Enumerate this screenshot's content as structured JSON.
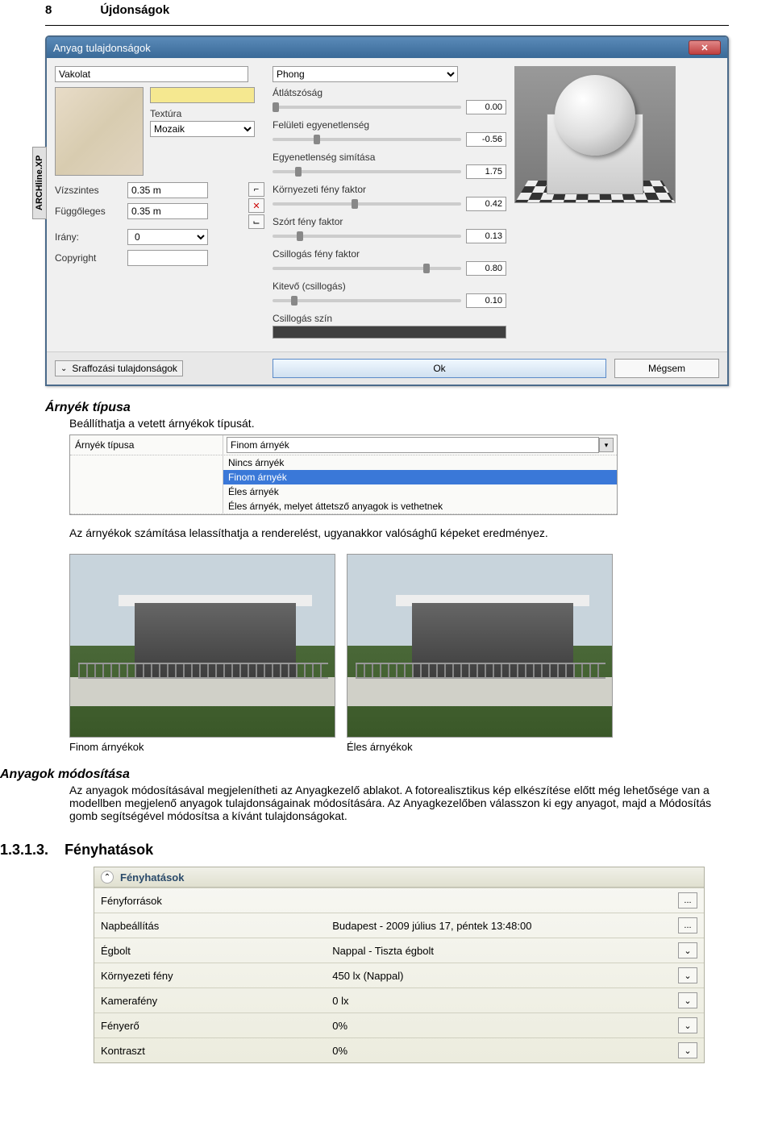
{
  "page": {
    "number": "8",
    "header": "Újdonságok"
  },
  "dialog": {
    "title": "Anyag tulajdonságok",
    "sideTab": "ARCHline.XP",
    "nameValue": "Vakolat",
    "textureLabel": "Textúra",
    "textureValue": "Mozaik",
    "rows": {
      "horizontal": {
        "label": "Vízszintes",
        "value": "0.35 m"
      },
      "vertical": {
        "label": "Függőleges",
        "value": "0.35 m"
      },
      "direction": {
        "label": "Irány:",
        "value": "0"
      },
      "copyright": {
        "label": "Copyright",
        "value": ""
      }
    },
    "shader": {
      "value": "Phong"
    },
    "sliders": {
      "transparency": {
        "label": "Átlátszóság",
        "value": "0.00",
        "pos": 0
      },
      "bump": {
        "label": "Felületi egyenetlenség",
        "value": "-0.56",
        "pos": 22
      },
      "bumpSmooth": {
        "label": "Egyenetlenség simítása",
        "value": "1.75",
        "pos": 12
      },
      "ambient": {
        "label": "Környezeti fény faktor",
        "value": "0.42",
        "pos": 42
      },
      "diffuse": {
        "label": "Szórt fény faktor",
        "value": "0.13",
        "pos": 13
      },
      "specular": {
        "label": "Csillogás fény faktor",
        "value": "0.80",
        "pos": 80
      },
      "specExp": {
        "label": "Kitevő (csillogás)",
        "value": "0.10",
        "pos": 10
      },
      "specColor": {
        "label": "Csillogás szín"
      }
    },
    "footer": {
      "sraf": "Sraffozási tulajdonságok",
      "ok": "Ok",
      "cancel": "Mégsem"
    }
  },
  "article": {
    "shadowTitle": "Árnyék típusa",
    "shadowIntro": "Beállíthatja a vetett árnyékok típusát.",
    "shadowNote": "Az árnyékok számítása lelassíthatja a renderelést, ugyanakkor valósághű képeket eredményez.",
    "cap1": "Finom árnyékok",
    "cap2": "Éles árnyékok",
    "matTitle": "Anyagok módosítása",
    "matBody": "Az anyagok módosításával megjelenítheti az Anyagkezelő ablakot. A fotorealisztikus kép elkészítése előtt még lehetősége van a modellben megjelenő anyagok tulajdonságainak módosítására. Az Anyagkezelőben válasszon ki egy anyagot, majd a Módosítás gomb segítségével módosítsa a kívánt tulajdonságokat.",
    "sectionNum": "1.3.1.3.",
    "sectionTitle": "Fényhatások"
  },
  "shadowPanel": {
    "label": "Árnyék típusa",
    "value": "Finom árnyék",
    "options": [
      "Nincs árnyék",
      "Finom árnyék",
      "Éles árnyék",
      "Éles árnyék, melyet áttetsző anyagok is vethetnek"
    ],
    "selectedIndex": 1
  },
  "lightPanel": {
    "title": "Fényhatások",
    "rows": [
      {
        "label": "Fényforrások",
        "value": "",
        "btn": "..."
      },
      {
        "label": "Napbeállítás",
        "value": "Budapest - 2009 július 17, péntek 13:48:00",
        "btn": "..."
      },
      {
        "label": "Égbolt",
        "value": "Nappal - Tiszta égbolt",
        "btn": "v"
      },
      {
        "label": "Környezeti fény",
        "value": "450 lx (Nappal)",
        "btn": "v"
      },
      {
        "label": "Kamerafény",
        "value": "0 lx",
        "btn": "v"
      },
      {
        "label": "Fényerő",
        "value": "0%",
        "btn": "v"
      },
      {
        "label": "Kontraszt",
        "value": "0%",
        "btn": "v"
      }
    ]
  }
}
